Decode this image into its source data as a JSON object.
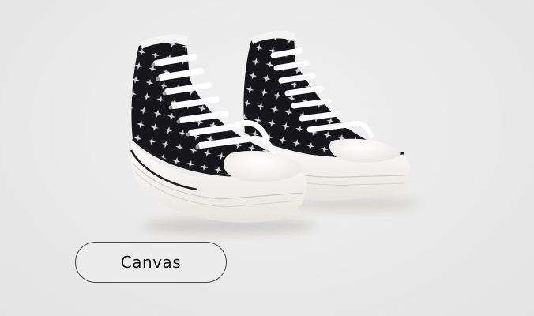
{
  "category": {
    "label": "Canvas"
  },
  "product": {
    "icon": "black-star-pattern-high-top-sneakers-image",
    "colors": {
      "upper": "#17171b",
      "sole": "#f7f5f0",
      "toe_cap": "#fbfbf8",
      "star": "#f2f2f2",
      "background": "#ebebeb"
    }
  }
}
